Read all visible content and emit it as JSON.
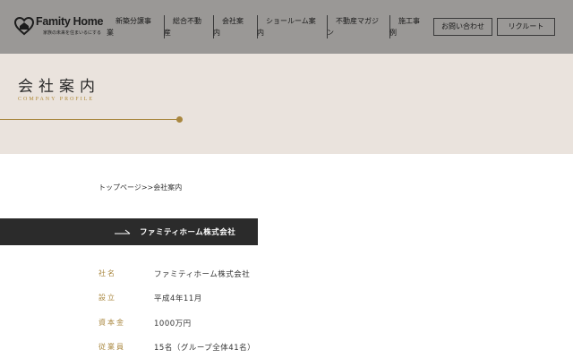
{
  "header": {
    "logo_text": "Famity Home",
    "logo_tagline": "家族の未来を住まいるにする",
    "nav": [
      {
        "line1": "新築分譲事",
        "line2": "業"
      },
      {
        "line1": "総合不動",
        "line2": "産"
      },
      {
        "line1": "会社案",
        "line2": "内"
      },
      {
        "line1": "ショールーム案",
        "line2": "内"
      },
      {
        "line1": "不動産マガジ",
        "line2": "ン"
      },
      {
        "line1": "施工事",
        "line2": "例"
      }
    ],
    "contact_button": "お問い合わせ",
    "recruit_button": "リクルート"
  },
  "hero": {
    "title": "会社案内",
    "subtitle": "COMPANY PROFILE"
  },
  "breadcrumb": "トップページ>>会社案内",
  "section": {
    "title": "ファミティホーム株式会社"
  },
  "profile": [
    {
      "label": "社名",
      "value": "ファミティホーム株式会社"
    },
    {
      "label": "設立",
      "value": "平成4年11月"
    },
    {
      "label": "資本金",
      "value": "1000万円"
    },
    {
      "label": "従業員",
      "value": "15名（グループ全体41名）"
    }
  ],
  "colors": {
    "header_bg": "#9a9896",
    "hero_bg": "#eae3dd",
    "accent_gold": "#a9873f",
    "band_bg": "#2b2b2b"
  }
}
